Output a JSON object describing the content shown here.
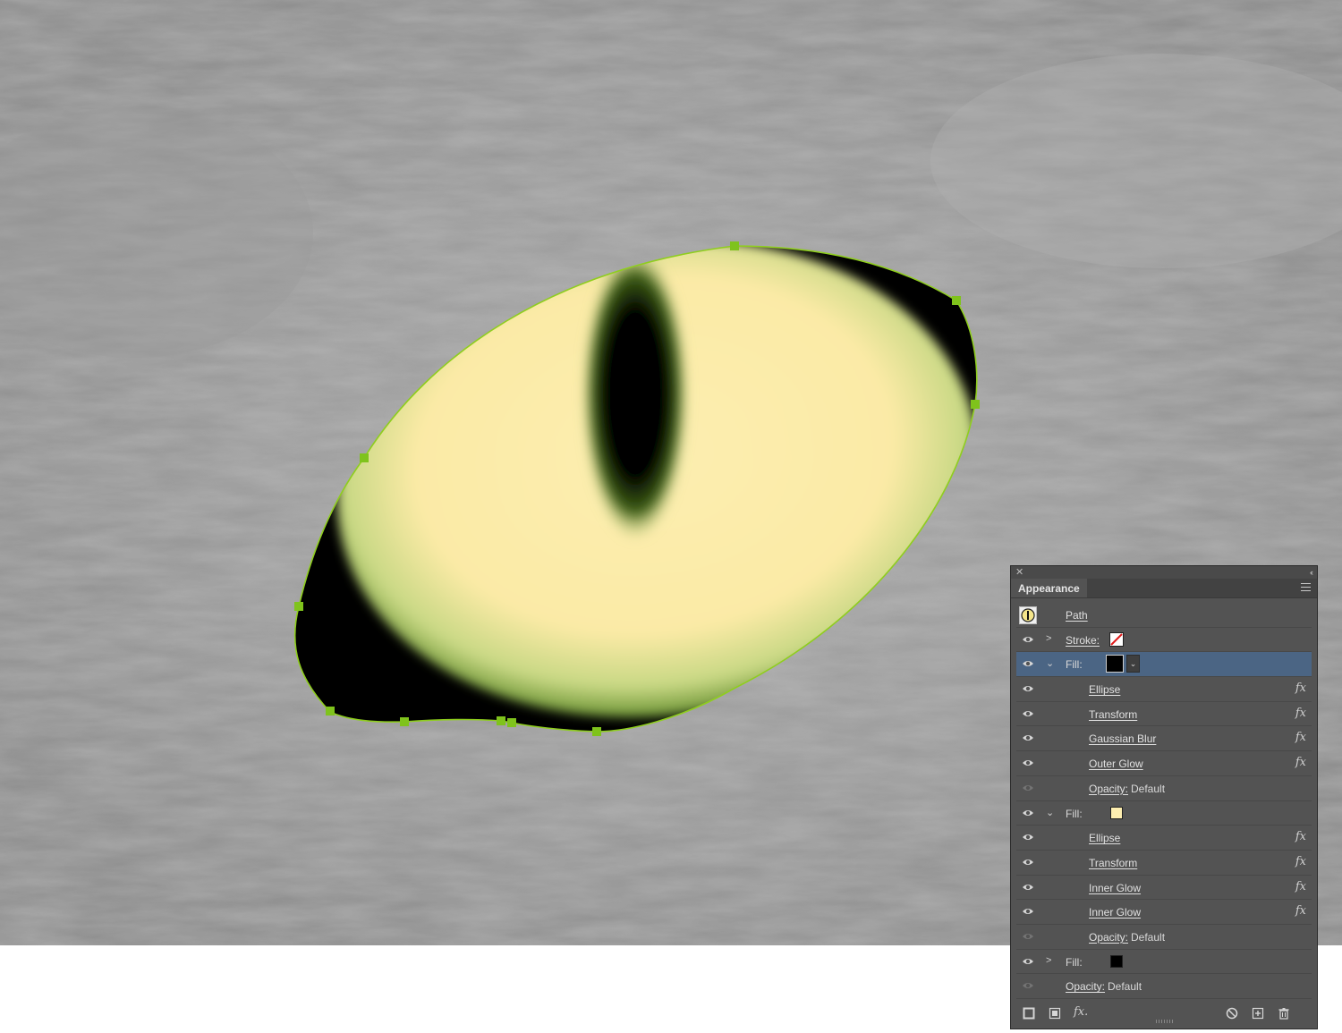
{
  "panel": {
    "title": "Appearance",
    "path_label": "Path",
    "stroke_label": "Stroke:",
    "rows": [
      {
        "kind": "fill",
        "label": "Fill:",
        "expanded": true,
        "selected": true,
        "swatch": "#000000"
      },
      {
        "kind": "effect",
        "label": "Ellipse"
      },
      {
        "kind": "effect",
        "label": "Transform"
      },
      {
        "kind": "effect",
        "label": "Gaussian Blur"
      },
      {
        "kind": "effect",
        "label": "Outer Glow"
      },
      {
        "kind": "opacity",
        "label": "Opacity:",
        "value": "Default"
      },
      {
        "kind": "fill",
        "label": "Fill:",
        "expanded": true,
        "swatch": "#fdeeb0"
      },
      {
        "kind": "effect",
        "label": "Ellipse"
      },
      {
        "kind": "effect",
        "label": "Transform"
      },
      {
        "kind": "effect",
        "label": "Inner Glow"
      },
      {
        "kind": "effect",
        "label": "Inner Glow"
      },
      {
        "kind": "opacity",
        "label": "Opacity:",
        "value": "Default"
      },
      {
        "kind": "fill",
        "label": "Fill:",
        "expanded": false,
        "swatch": "#000000"
      },
      {
        "kind": "opacity-top",
        "label": "Opacity:",
        "value": "Default"
      }
    ],
    "fx_glyph": "fx",
    "add_effect_label": "fx."
  },
  "colors": {
    "selection_handle": "#7fc31c",
    "iris_light": "#fdeeb0",
    "iris_dark": "#6a8a1e",
    "selected_row": "#4b6584"
  }
}
